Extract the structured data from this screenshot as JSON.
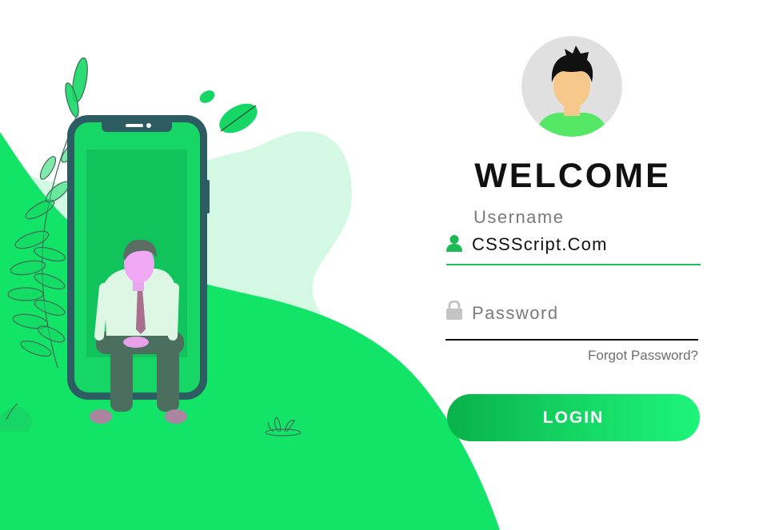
{
  "login_form": {
    "title": "WELCOME",
    "username": {
      "label": "Username",
      "value": "CSSScript.Com",
      "icon": "user-icon"
    },
    "password": {
      "placeholder": "Password",
      "value": "",
      "icon": "lock-icon"
    },
    "forgot_link": "Forgot Password?",
    "login_button": "LOGIN"
  },
  "colors": {
    "accent_green": "#12e468",
    "pale_green": "#d3f9e4",
    "username_underline": "#1fbf5b",
    "button_gradient": [
      "#08b24a",
      "#1df57a"
    ]
  }
}
